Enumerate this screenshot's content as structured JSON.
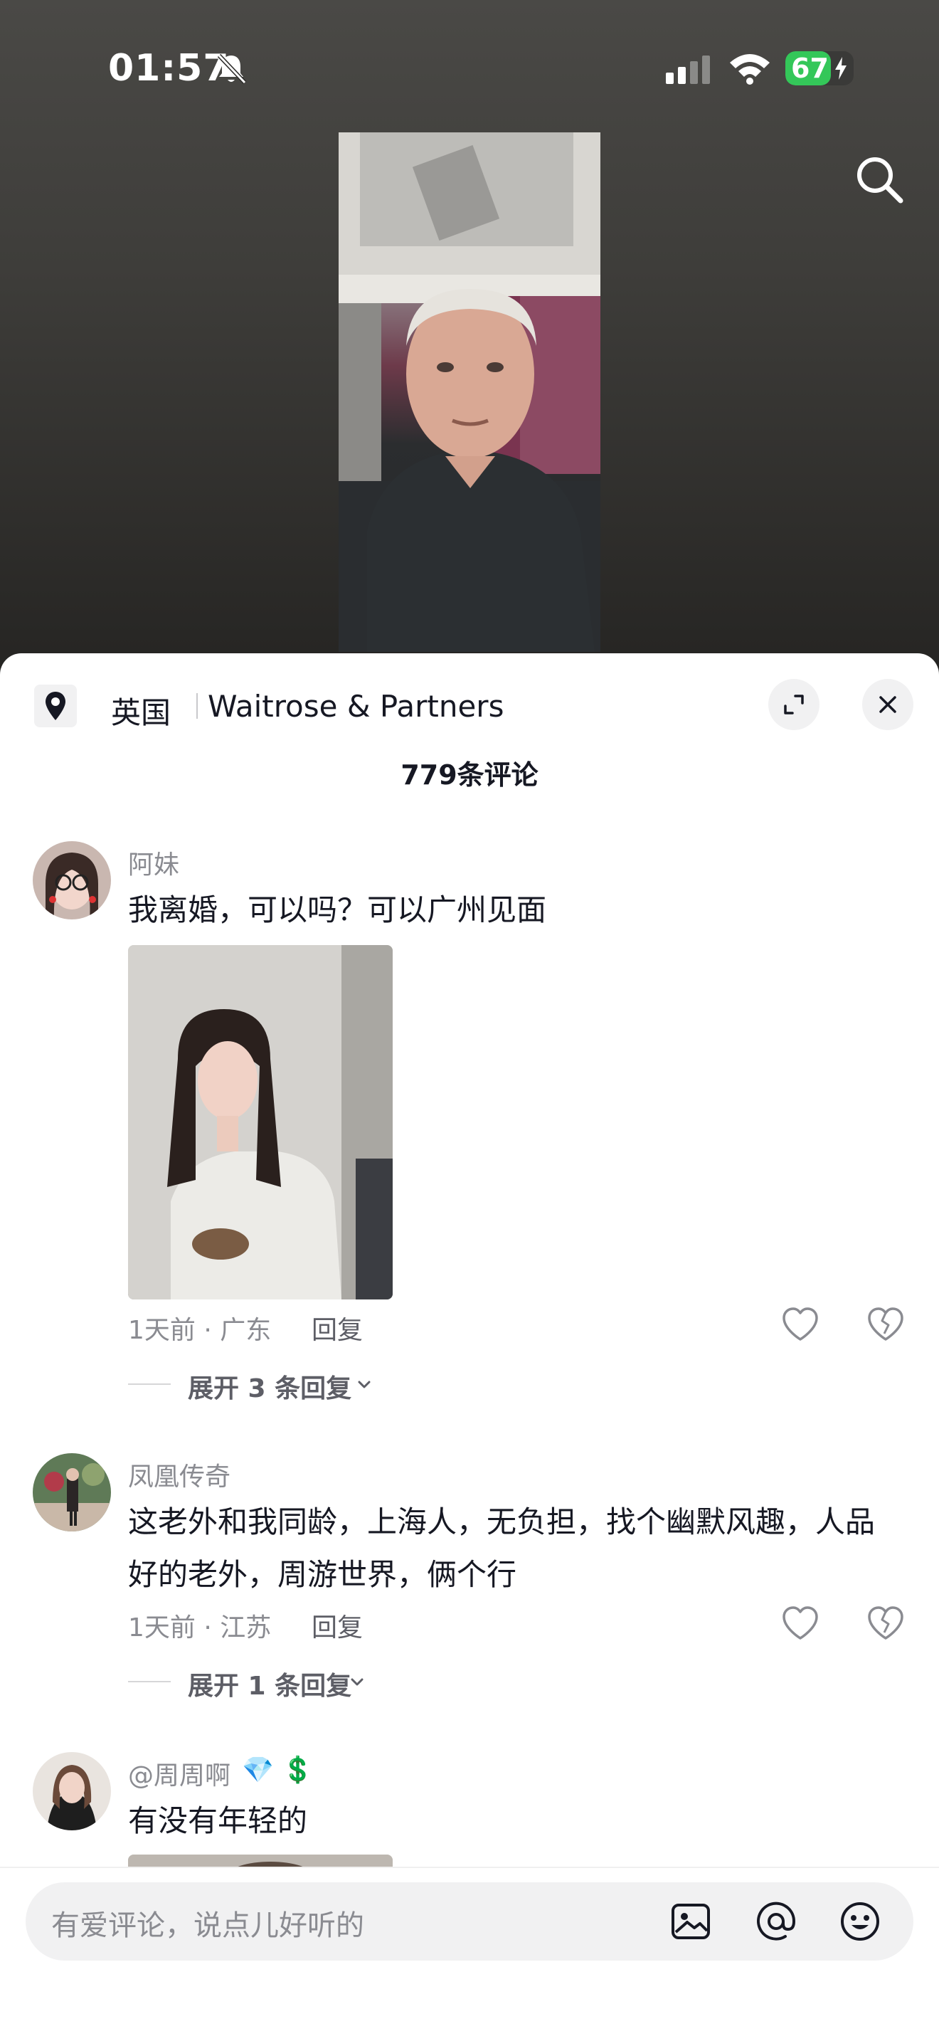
{
  "status_bar": {
    "time": "01:57",
    "battery_level": "67",
    "battery_fraction": 0.67
  },
  "location": {
    "country": "英国",
    "place": "Waitrose & Partners"
  },
  "comment_count_label": "779条评论",
  "comments": [
    {
      "username": "阿妹",
      "text": "我离婚，可以吗？可以广州见面",
      "meta": "1天前 · 广东",
      "reply_label": "回复",
      "expand_label": "展开 3 条回复"
    },
    {
      "username": "凤凰传奇",
      "text": "这老外和我同龄，上海人，无负担，找个幽默风趣，人品好的老外，周游世界，俩个行",
      "meta": "1天前 · 江苏",
      "reply_label": "回复",
      "expand_label": "展开 1 条回复"
    },
    {
      "username": "@周周啊",
      "username_emojis": "💎 💲",
      "text": "有没有年轻的"
    }
  ],
  "input": {
    "placeholder": "有爱评论，说点儿好听的"
  },
  "colors": {
    "accent_battery": "#34c759",
    "text_primary": "#161823",
    "text_secondary": "#8a8b91"
  },
  "icons": [
    "bell-slash-icon",
    "cellular-signal-icon",
    "wifi-icon",
    "battery-icon",
    "search-icon",
    "location-pin-icon",
    "expand-icon",
    "close-icon",
    "heart-icon",
    "broken-heart-icon",
    "chevron-down-icon",
    "image-icon",
    "at-icon",
    "emoji-icon"
  ]
}
